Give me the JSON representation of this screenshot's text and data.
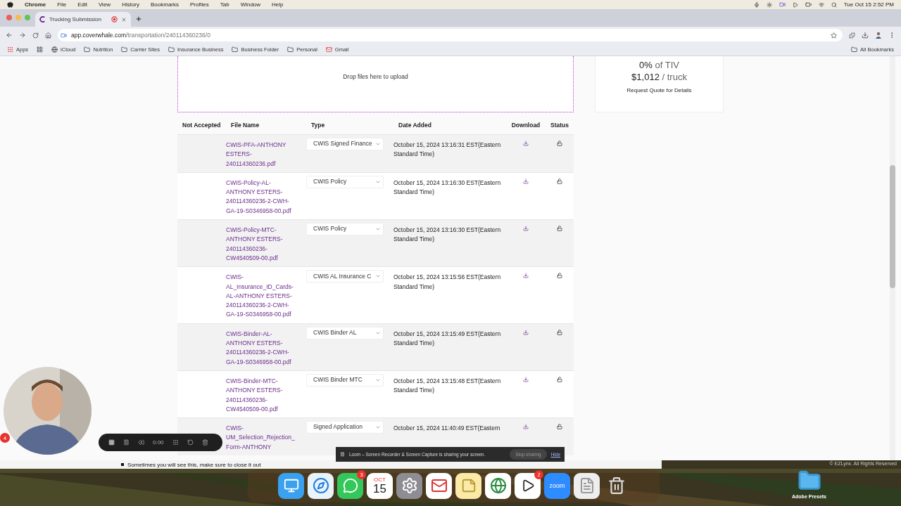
{
  "menu_bar": {
    "app": "Chrome",
    "menus": [
      "File",
      "Edit",
      "View",
      "History",
      "Bookmarks",
      "Profiles",
      "Tab",
      "Window",
      "Help"
    ],
    "clock": "Tue Oct 15  2:52 PM"
  },
  "browser": {
    "tab": {
      "title": "Trucking Submission",
      "recording": true
    },
    "url_host": "app.coverwhale.com",
    "url_path": "/transportation/240114360236/0",
    "bookmarks": [
      {
        "kind": "apps",
        "label": "Apps"
      },
      {
        "kind": "grid"
      },
      {
        "kind": "globe",
        "label": "iCloud"
      },
      {
        "kind": "folder",
        "label": "Nutrition"
      },
      {
        "kind": "folder",
        "label": "Carrier Sites"
      },
      {
        "kind": "folder",
        "label": "Insurance Business"
      },
      {
        "kind": "folder",
        "label": "Business Folder"
      },
      {
        "kind": "folder",
        "label": "Personal"
      },
      {
        "kind": "gmail",
        "label": "Gmail"
      }
    ],
    "all_bookmarks": "All Bookmarks"
  },
  "upload": {
    "prompt": "Drop files here to upload"
  },
  "table": {
    "columns": [
      "Not Accepted",
      "File Name",
      "Type",
      "Date Added",
      "Download",
      "Status"
    ],
    "rows": [
      {
        "file_name": [
          "CWIS-PFA-ANTHONY",
          "ESTERS-",
          "240114360236.pdf"
        ],
        "type": "CWIS Signed Finance",
        "date": [
          "October 15, 2024 13:16:31 EST(Eastern",
          "Standard Time)"
        ]
      },
      {
        "file_name": [
          "CWIS-Policy-AL-",
          "ANTHONY ESTERS-",
          "240114360236-2-CWH-",
          "GA-19-S0346958-00.pdf"
        ],
        "type": "CWIS Policy",
        "date": [
          "October 15, 2024 13:16:30 EST(Eastern",
          "Standard Time)"
        ]
      },
      {
        "file_name": [
          "CWIS-Policy-MTC-",
          "ANTHONY ESTERS-",
          "240114360236-",
          "CW4540509-00.pdf"
        ],
        "type": "CWIS Policy",
        "date": [
          "October 15, 2024 13:16:30 EST(Eastern",
          "Standard Time)"
        ]
      },
      {
        "file_name": [
          "CWIS-",
          "AL_Insurance_ID_Cards-",
          "AL-ANTHONY ESTERS-",
          "240114360236-2-CWH-",
          "GA-19-S0346958-00.pdf"
        ],
        "type": "CWIS AL Insurance C",
        "date": [
          "October 15, 2024 13:15:56 EST(Eastern",
          "Standard Time)"
        ]
      },
      {
        "file_name": [
          "CWIS-Binder-AL-",
          "ANTHONY ESTERS-",
          "240114360236-2-CWH-",
          "GA-19-S0346958-00.pdf"
        ],
        "type": "CWIS Binder AL",
        "date": [
          "October 15, 2024 13:15:49 EST(Eastern",
          "Standard Time)"
        ]
      },
      {
        "file_name": [
          "CWIS-Binder-MTC-",
          "ANTHONY ESTERS-",
          "240114360236-",
          "CW4540509-00.pdf"
        ],
        "type": "CWIS Binder MTC",
        "date": [
          "October 15, 2024 13:15:48 EST(Eastern",
          "Standard Time)"
        ]
      },
      {
        "file_name": [
          "CWIS-",
          "UM_Selection_Rejection_",
          "Form-ANTHONY"
        ],
        "type": "Signed Application",
        "date": [
          "October 15, 2024 11:40:49 EST(Eastern"
        ]
      }
    ]
  },
  "quote_card": {
    "rate": "0%",
    "rate_unit": "of TIV",
    "price": "$1,012",
    "price_unit": "/ truck",
    "link": "Request Quote for Details"
  },
  "recorder": {
    "time": "0:00",
    "badge": "4"
  },
  "loom_banner": {
    "message": "Loom – Screen Recorder & Screen Capture is sharing your screen.",
    "stop": "Stop sharing",
    "hide": "Hide"
  },
  "document_note": "Sometimes you will see this, make sure to close it out",
  "copyright": "© EZLynx. All Rights Reserved",
  "dock": [
    {
      "kind": "finder"
    },
    {
      "kind": "safari"
    },
    {
      "kind": "messages",
      "badge": "3"
    },
    {
      "kind": "calendar",
      "month": "OCT",
      "day": "15"
    },
    {
      "kind": "settings"
    },
    {
      "kind": "mail"
    },
    {
      "kind": "notes"
    },
    {
      "kind": "chrome"
    },
    {
      "kind": "v",
      "badge": "2"
    },
    {
      "kind": "zoom",
      "label": "zoom"
    },
    {
      "kind": "pdf"
    },
    {
      "kind": "trash"
    }
  ],
  "desktop": {
    "folder": "Adobe Presets"
  }
}
